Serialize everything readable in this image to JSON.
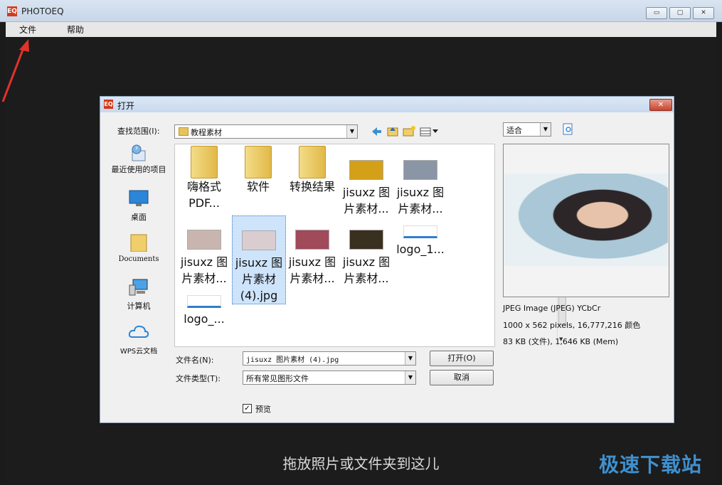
{
  "window": {
    "title": "PHOTOEQ",
    "logo": "EQ",
    "controls": [
      "▭",
      "▢",
      "✕"
    ]
  },
  "menu": [
    "文件",
    "帮助"
  ],
  "drop_hint": "拖放照片或文件夹到这儿",
  "watermark": "极速下载站",
  "dialog": {
    "title": "打开",
    "icon": "EQ",
    "close": "✕",
    "look_in_label": "查找范围(I):",
    "look_in_value": "教程素材",
    "places": [
      {
        "label": "最近使用的项目",
        "icon": "recent-icon"
      },
      {
        "label": "桌面",
        "icon": "desktop-icon"
      },
      {
        "label": "Documents",
        "icon": "documents-folder-icon"
      },
      {
        "label": "计算机",
        "icon": "computer-icon"
      },
      {
        "label": "WPS云文档",
        "icon": "cloud-icon"
      }
    ],
    "files": [
      {
        "label": "嗨格式\nPDF...",
        "type": "folder"
      },
      {
        "label": "软件",
        "type": "folder"
      },
      {
        "label": "转换结果",
        "type": "folder"
      },
      {
        "label": "jisuxz 图\n片素材...",
        "type": "image",
        "color": "#d4a017"
      },
      {
        "label": "jisuxz 图\n片素材...",
        "type": "image",
        "color": "#8a96a6"
      },
      {
        "label": "jisuxz 图\n片素材...",
        "type": "image",
        "color": "#c9b5b0"
      },
      {
        "label": "jisuxz 图\n片素材\n(4).jpg",
        "type": "image",
        "color": "#d9cdd0",
        "selected": true
      },
      {
        "label": "jisuxz 图\n片素材...",
        "type": "image",
        "color": "#a04a5a"
      },
      {
        "label": "jisuxz 图\n片素材...",
        "type": "image",
        "color": "#3a3020"
      },
      {
        "label": "logo_1...",
        "type": "logo",
        "color": "#2f7fc9"
      },
      {
        "label": "logo_...",
        "type": "logo",
        "color": "#2f7fc9"
      }
    ],
    "filename_label": "文件名(N):",
    "filename_value": "jisuxz 图片素材 (4).jpg",
    "filetype_label": "文件类型(T):",
    "filetype_value": "所有常见图形文件",
    "open_button": "打开(O)",
    "cancel_button": "取消",
    "preview_checkbox_label": "预览",
    "preview_checked": true,
    "zoom_value": "适合",
    "preview_info": [
      "JPEG Image (JPEG) YCbCr",
      "1000 x 562 pixels, 16,777,216 颜色",
      "83 KB (文件), 1,646 KB (Mem)"
    ]
  }
}
